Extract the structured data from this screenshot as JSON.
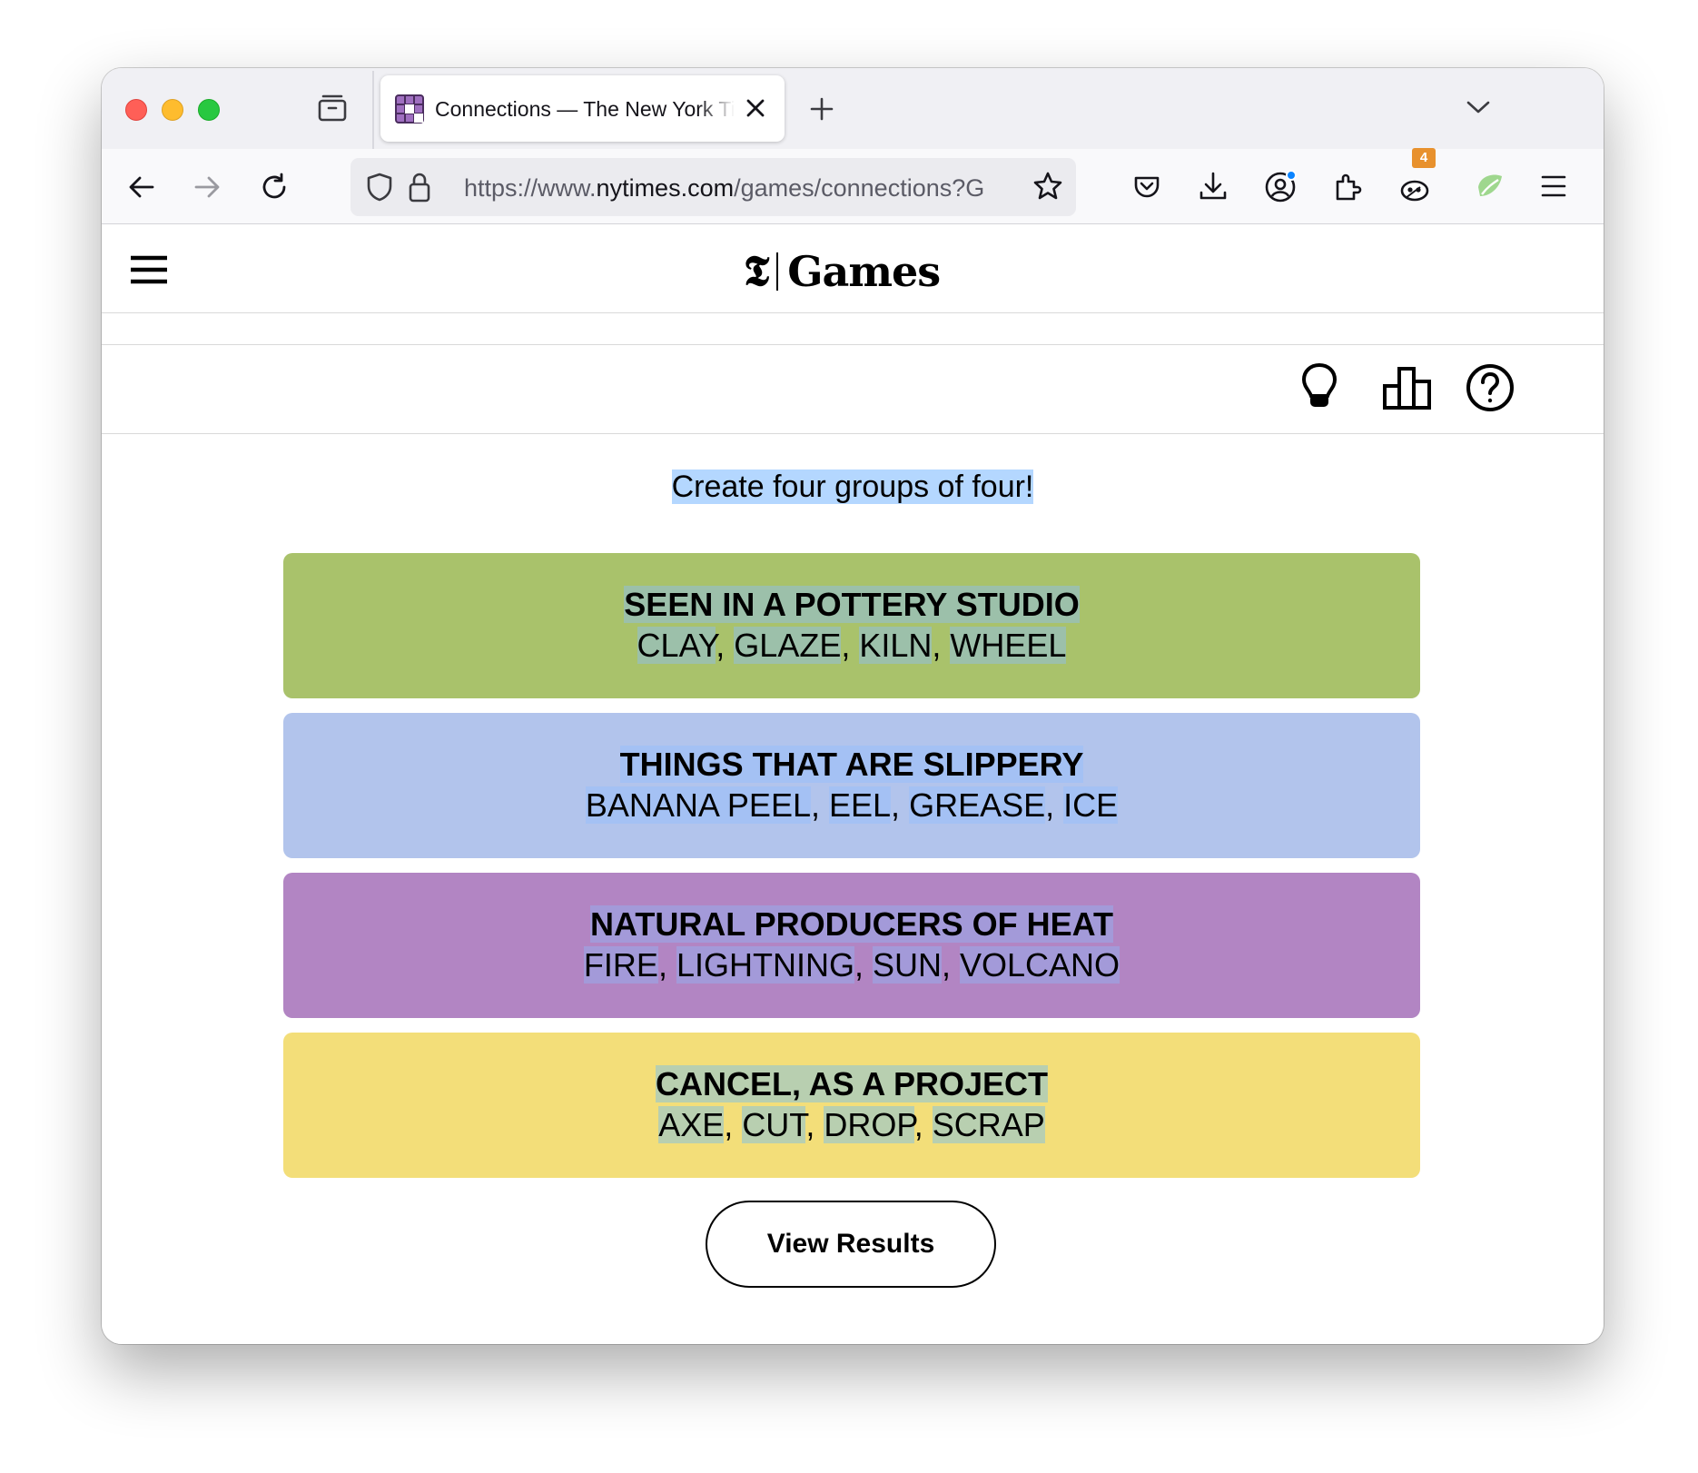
{
  "browser": {
    "tab": {
      "title": "Connections — The New York Times"
    },
    "url": {
      "prefix": "https://www.",
      "host": "nytimes.com",
      "path": "/games/connections?G"
    },
    "extension_badge": "4"
  },
  "site": {
    "logo_mark": "𝕿",
    "logo_text": "Games"
  },
  "game": {
    "instructions": "Create four groups of four!",
    "groups": [
      {
        "title": "SEEN IN A POTTERY STUDIO",
        "members": [
          "CLAY",
          "GLAZE",
          "KILN",
          "WHEEL"
        ],
        "color": "#a9c26b",
        "highlight": "#9cc0aa"
      },
      {
        "title": "THINGS THAT ARE SLIPPERY",
        "members": [
          "BANANA PEEL",
          "EEL",
          "GREASE",
          "ICE"
        ],
        "color": "#b2c4ec",
        "highlight": "#a4c1f4"
      },
      {
        "title": "NATURAL PRODUCERS OF HEAT",
        "members": [
          "FIRE",
          "LIGHTNING",
          "SUN",
          "VOLCANO"
        ],
        "color": "#b285c3",
        "highlight": "#a39ad9"
      },
      {
        "title": "CANCEL, AS A PROJECT",
        "members": [
          "AXE",
          "CUT",
          "DROP",
          "SCRAP"
        ],
        "color": "#f3de79",
        "highlight": "#b8cfb0"
      }
    ],
    "results_button": "View Results"
  },
  "icons": [
    "tab-overview-icon",
    "nyt-connections-favicon",
    "close-tab-icon",
    "new-tab-icon",
    "tab-list-chevron-icon",
    "back-arrow-icon",
    "forward-arrow-icon",
    "reload-icon",
    "tracking-shield-icon",
    "lock-icon",
    "bookmark-star-icon",
    "pocket-icon",
    "download-icon",
    "account-icon",
    "extensions-icon",
    "extension-icon",
    "leaf-extension-icon",
    "app-menu-icon",
    "hamburger-menu-icon",
    "hint-lightbulb-icon",
    "stats-icon",
    "help-icon"
  ]
}
